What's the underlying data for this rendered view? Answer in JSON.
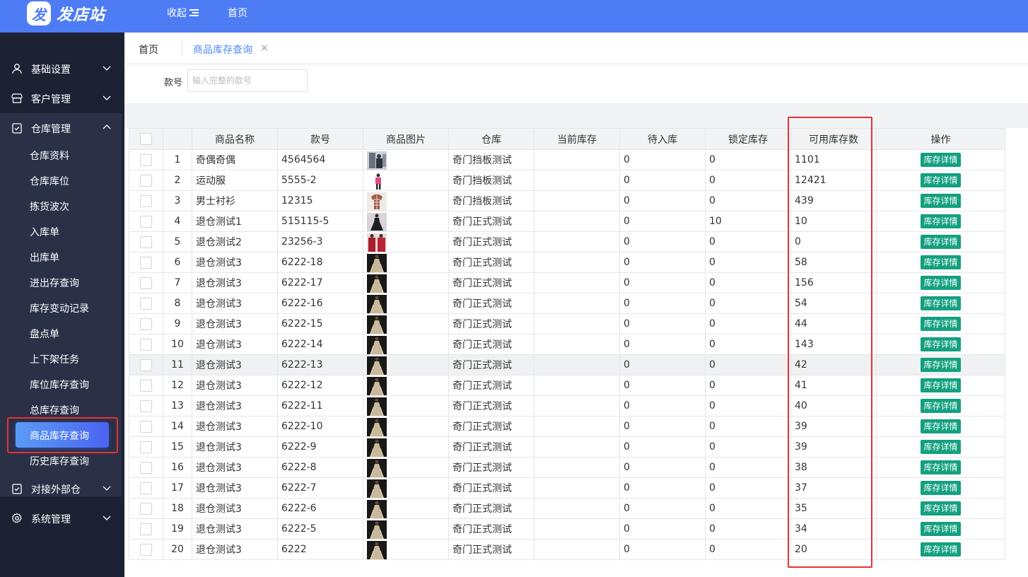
{
  "header": {
    "logo_glyph": "发",
    "brand": "发店站",
    "collapse_label": "收起",
    "home_link": "首页"
  },
  "sidebar": {
    "groups": [
      {
        "label": "基础设置",
        "icon": "user-icon"
      },
      {
        "label": "客户管理",
        "icon": "store-icon"
      },
      {
        "label": "仓库管理",
        "icon": "clipboard-check-icon"
      },
      {
        "label": "对接外部仓",
        "icon": "clipboard-check-icon"
      },
      {
        "label": "系统管理",
        "icon": "gear-icon"
      }
    ],
    "sub_items": [
      "仓库资料",
      "仓库库位",
      "拣货波次",
      "入库单",
      "出库单",
      "进出存查询",
      "库存变动记录",
      "盘点单",
      "上下架任务",
      "库位库存查询",
      "总库存查询",
      "商品库存查询",
      "历史库存查询"
    ],
    "active_sub": "商品库存查询"
  },
  "tabs": {
    "home": "首页",
    "active": "商品库存查询",
    "close": "×"
  },
  "filter": {
    "label": "款号",
    "placeholder": "输入完整的款号",
    "value": ""
  },
  "table": {
    "headers": [
      "商品名称",
      "款号",
      "商品图片",
      "仓库",
      "当前库存",
      "待入库",
      "锁定库存",
      "可用库存数",
      "操作"
    ],
    "action_label": "库存详情",
    "rows": [
      {
        "idx": "1",
        "name": "奇偶奇偶",
        "sku": "4564564",
        "img": "person",
        "wh": "奇门挡板测试",
        "cur": "",
        "pending": "0",
        "locked": "0",
        "avail": "1101"
      },
      {
        "idx": "2",
        "name": "运动服",
        "sku": "5555-2",
        "img": "pink",
        "wh": "奇门挡板测试",
        "cur": "",
        "pending": "0",
        "locked": "0",
        "avail": "12421"
      },
      {
        "idx": "3",
        "name": "男士衬衫",
        "sku": "12315",
        "img": "shirt",
        "wh": "奇门挡板测试",
        "cur": "",
        "pending": "0",
        "locked": "0",
        "avail": "439"
      },
      {
        "idx": "4",
        "name": "退仓测试1",
        "sku": "515115-5",
        "img": "dress",
        "wh": "奇门正式测试",
        "cur": "",
        "pending": "0",
        "locked": "10",
        "avail": "10"
      },
      {
        "idx": "5",
        "name": "退仓测试2",
        "sku": "23256-3",
        "img": "red",
        "wh": "奇门正式测试",
        "cur": "",
        "pending": "0",
        "locked": "0",
        "avail": "0"
      },
      {
        "idx": "6",
        "name": "退仓测试3",
        "sku": "6222-18",
        "img": "gold",
        "wh": "奇门正式测试",
        "cur": "",
        "pending": "0",
        "locked": "0",
        "avail": "58"
      },
      {
        "idx": "7",
        "name": "退仓测试3",
        "sku": "6222-17",
        "img": "gold",
        "wh": "奇门正式测试",
        "cur": "",
        "pending": "0",
        "locked": "0",
        "avail": "156"
      },
      {
        "idx": "8",
        "name": "退仓测试3",
        "sku": "6222-16",
        "img": "gold",
        "wh": "奇门正式测试",
        "cur": "",
        "pending": "0",
        "locked": "0",
        "avail": "54"
      },
      {
        "idx": "9",
        "name": "退仓测试3",
        "sku": "6222-15",
        "img": "gold",
        "wh": "奇门正式测试",
        "cur": "",
        "pending": "0",
        "locked": "0",
        "avail": "44"
      },
      {
        "idx": "10",
        "name": "退仓测试3",
        "sku": "6222-14",
        "img": "gold",
        "wh": "奇门正式测试",
        "cur": "",
        "pending": "0",
        "locked": "0",
        "avail": "143"
      },
      {
        "idx": "11",
        "name": "退仓测试3",
        "sku": "6222-13",
        "img": "gold",
        "wh": "奇门正式测试",
        "cur": "",
        "pending": "0",
        "locked": "0",
        "avail": "42",
        "hl": true
      },
      {
        "idx": "12",
        "name": "退仓测试3",
        "sku": "6222-12",
        "img": "gold",
        "wh": "奇门正式测试",
        "cur": "",
        "pending": "0",
        "locked": "0",
        "avail": "41"
      },
      {
        "idx": "13",
        "name": "退仓测试3",
        "sku": "6222-11",
        "img": "gold",
        "wh": "奇门正式测试",
        "cur": "",
        "pending": "0",
        "locked": "0",
        "avail": "40"
      },
      {
        "idx": "14",
        "name": "退仓测试3",
        "sku": "6222-10",
        "img": "gold",
        "wh": "奇门正式测试",
        "cur": "",
        "pending": "0",
        "locked": "0",
        "avail": "39"
      },
      {
        "idx": "15",
        "name": "退仓测试3",
        "sku": "6222-9",
        "img": "gold",
        "wh": "奇门正式测试",
        "cur": "",
        "pending": "0",
        "locked": "0",
        "avail": "39"
      },
      {
        "idx": "16",
        "name": "退仓测试3",
        "sku": "6222-8",
        "img": "gold",
        "wh": "奇门正式测试",
        "cur": "",
        "pending": "0",
        "locked": "0",
        "avail": "38"
      },
      {
        "idx": "17",
        "name": "退仓测试3",
        "sku": "6222-7",
        "img": "gold",
        "wh": "奇门正式测试",
        "cur": "",
        "pending": "0",
        "locked": "0",
        "avail": "37"
      },
      {
        "idx": "18",
        "name": "退仓测试3",
        "sku": "6222-6",
        "img": "gold",
        "wh": "奇门正式测试",
        "cur": "",
        "pending": "0",
        "locked": "0",
        "avail": "35"
      },
      {
        "idx": "19",
        "name": "退仓测试3",
        "sku": "6222-5",
        "img": "gold",
        "wh": "奇门正式测试",
        "cur": "",
        "pending": "0",
        "locked": "0",
        "avail": "34"
      },
      {
        "idx": "20",
        "name": "退仓测试3",
        "sku": "6222",
        "img": "gold",
        "wh": "奇门正式测试",
        "cur": "",
        "pending": "0",
        "locked": "0",
        "avail": "20"
      }
    ]
  },
  "colors": {
    "header_bg": "#4d7cf5",
    "sidebar_bg": "#1c2234",
    "action_button": "#13a07f",
    "highlight_border": "#e53333",
    "active_tab": "#4d8cf5"
  }
}
